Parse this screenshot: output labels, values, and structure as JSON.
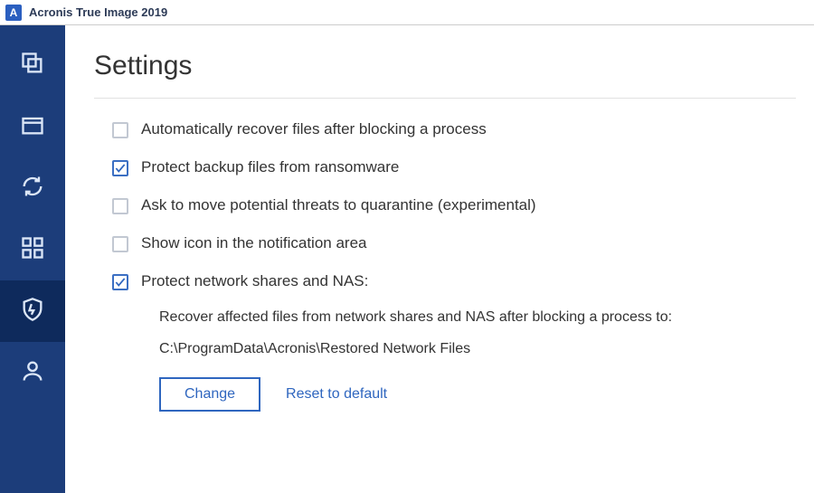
{
  "app": {
    "logo_letter": "A",
    "title": "Acronis True Image 2019"
  },
  "sidebar": {
    "items": [
      {
        "name": "backup",
        "active": false
      },
      {
        "name": "archive",
        "active": false
      },
      {
        "name": "sync",
        "active": false
      },
      {
        "name": "tools",
        "active": false
      },
      {
        "name": "active-protection",
        "active": true
      },
      {
        "name": "account",
        "active": false
      }
    ]
  },
  "page": {
    "title": "Settings",
    "options": [
      {
        "key": "auto_recover",
        "checked": false,
        "label": "Automatically recover files after blocking a process"
      },
      {
        "key": "protect_backup",
        "checked": true,
        "label": "Protect backup files from ransomware"
      },
      {
        "key": "ask_quarantine",
        "checked": false,
        "label": "Ask to move potential threats to quarantine (experimental)"
      },
      {
        "key": "show_icon",
        "checked": false,
        "label": "Show icon in the notification area"
      },
      {
        "key": "protect_nas",
        "checked": true,
        "label": "Protect network shares and NAS:"
      }
    ],
    "nas": {
      "description": "Recover affected files from network shares and NAS after blocking a process to:",
      "path": "C:\\ProgramData\\Acronis\\Restored Network Files",
      "change_label": "Change",
      "reset_label": "Reset to default"
    }
  }
}
